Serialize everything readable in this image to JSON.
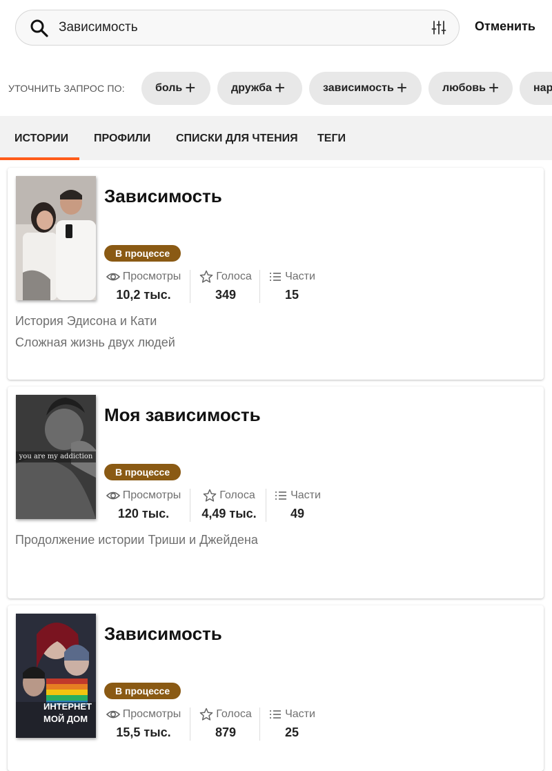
{
  "search": {
    "value": "Зависимость",
    "cancel_label": "Отменить"
  },
  "refine": {
    "label": "УТОЧНИТЬ ЗАПРОС ПО:",
    "chips": [
      "боль",
      "дружба",
      "зависимость",
      "любовь",
      "нар"
    ]
  },
  "tabs": [
    "ИСТОРИИ",
    "ПРОФИЛИ",
    "СПИСКИ ДЛЯ ЧТЕНИЯ",
    "ТЕГИ"
  ],
  "active_tab": "ИСТОРИИ",
  "stat_labels": {
    "views": "Просмотры",
    "votes": "Голоса",
    "parts": "Части"
  },
  "stories": [
    {
      "title": "Зависимость",
      "status": "В процессе",
      "views": "10,2 тыс.",
      "votes": "349",
      "parts": "15",
      "description": [
        "История Эдисона и Кати",
        "Сложная жизнь двух людей"
      ],
      "cover_text": ""
    },
    {
      "title": "Моя зависимость",
      "status": "В процессе",
      "views": "120 тыс.",
      "votes": "4,49 тыс.",
      "parts": "49",
      "description": [
        "Продолжение истории Триши и Джейдена"
      ],
      "cover_text": "you are my addiction"
    },
    {
      "title": "Зависимость",
      "status": "В процессе",
      "views": "15,5 тыс.",
      "votes": "879",
      "parts": "25",
      "description": [],
      "cover_text": "ИНТЕРНЕТ МОЙ ДОМ"
    }
  ],
  "colors": {
    "accent": "#ff5c1a",
    "badge": "#8a5a14"
  }
}
